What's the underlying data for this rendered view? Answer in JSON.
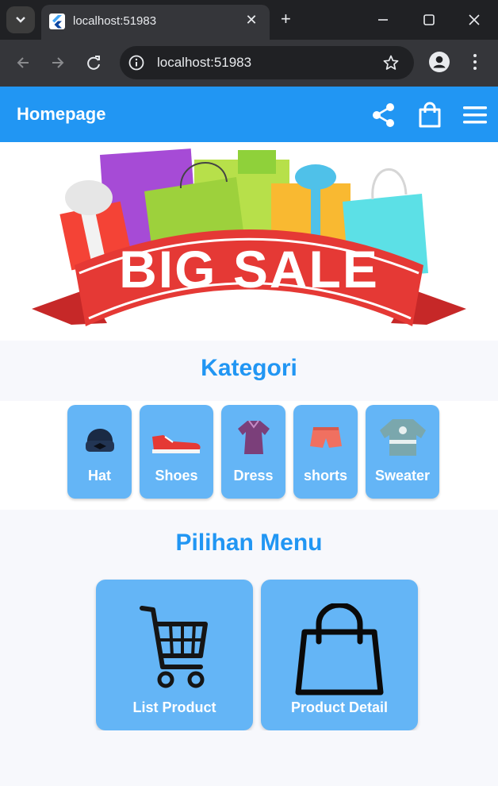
{
  "browser": {
    "tab_title": "localhost:51983",
    "url": "localhost:51983",
    "new_tab_symbol": "+",
    "close_tab_symbol": "✕"
  },
  "appbar": {
    "title": "Homepage",
    "color": "#2196f3"
  },
  "banner": {
    "text": "BIG SALE"
  },
  "kategori": {
    "title": "Kategori",
    "items": [
      {
        "label": "Hat",
        "icon": "hat-icon"
      },
      {
        "label": "Shoes",
        "icon": "shoes-icon"
      },
      {
        "label": "Dress",
        "icon": "dress-icon"
      },
      {
        "label": "shorts",
        "icon": "shorts-icon"
      },
      {
        "label": "Sweater",
        "icon": "sweater-icon"
      }
    ]
  },
  "menu": {
    "title": "Pilihan Menu",
    "items": [
      {
        "label": "List Product",
        "icon": "cart-icon"
      },
      {
        "label": "Product Detail",
        "icon": "shopping-bag-icon"
      }
    ]
  },
  "colors": {
    "accent": "#2196f3",
    "card": "#64b5f6"
  }
}
